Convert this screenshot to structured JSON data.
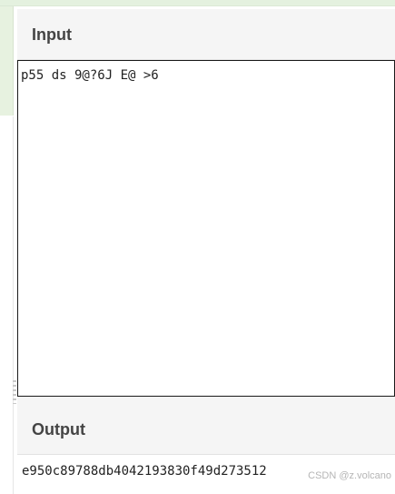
{
  "input": {
    "title": "Input",
    "value": "p55 ds 9@?6J E@ >6"
  },
  "output": {
    "title": "Output",
    "value": "e950c89788db4042193830f49d273512"
  },
  "watermark": "CSDN @z.volcano",
  "colors": {
    "top_strip": "#e4f1df",
    "header_bg": "#f5f5f5",
    "title_text": "#444444",
    "border": "#1a1a1a"
  }
}
